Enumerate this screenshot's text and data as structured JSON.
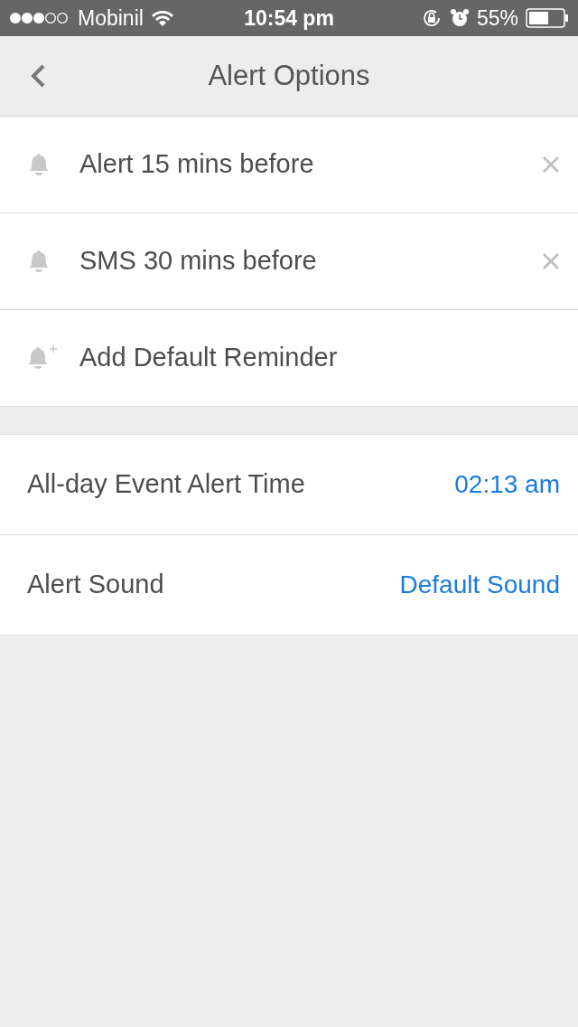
{
  "status_bar": {
    "carrier": "Mobinil",
    "time": "10:54 pm",
    "battery": "55%"
  },
  "nav": {
    "title": "Alert Options"
  },
  "reminders": [
    {
      "kind": "reminder",
      "label": "Alert 15 mins before"
    },
    {
      "kind": "reminder",
      "label": "SMS 30 mins before"
    },
    {
      "kind": "add",
      "label": "Add Default Reminder"
    }
  ],
  "settings": [
    {
      "label": "All-day Event Alert Time",
      "value": "02:13 am"
    },
    {
      "label": "Alert Sound",
      "value": "Default Sound"
    }
  ]
}
